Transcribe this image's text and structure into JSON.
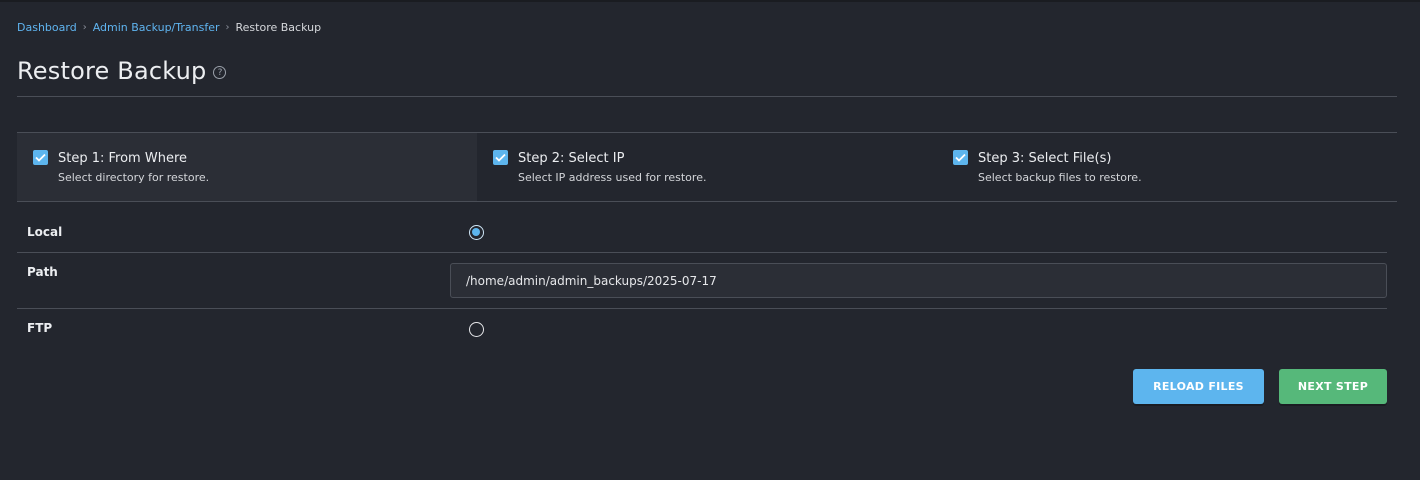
{
  "breadcrumb": {
    "items": [
      {
        "label": "Dashboard"
      },
      {
        "label": "Admin Backup/Transfer"
      },
      {
        "label": "Restore Backup"
      }
    ]
  },
  "page": {
    "title": "Restore Backup",
    "help_icon": "question-circle-icon"
  },
  "steps": [
    {
      "title": "Step 1: From Where",
      "subtitle": "Select directory for restore.",
      "checked": true,
      "active": true
    },
    {
      "title": "Step 2: Select IP",
      "subtitle": "Select IP address used for restore.",
      "checked": true,
      "active": false
    },
    {
      "title": "Step 3: Select File(s)",
      "subtitle": "Select backup files to restore.",
      "checked": true,
      "active": false
    }
  ],
  "form": {
    "local_label": "Local",
    "local_selected": true,
    "path_label": "Path",
    "path_value": "/home/admin/admin_backups/2025-07-17",
    "ftp_label": "FTP",
    "ftp_selected": false
  },
  "buttons": {
    "reload": "RELOAD FILES",
    "next": "NEXT STEP"
  },
  "colors": {
    "background": "#23262e",
    "accent_blue": "#5db5ee",
    "accent_green": "#56b87a",
    "link": "#5fb4f0"
  }
}
